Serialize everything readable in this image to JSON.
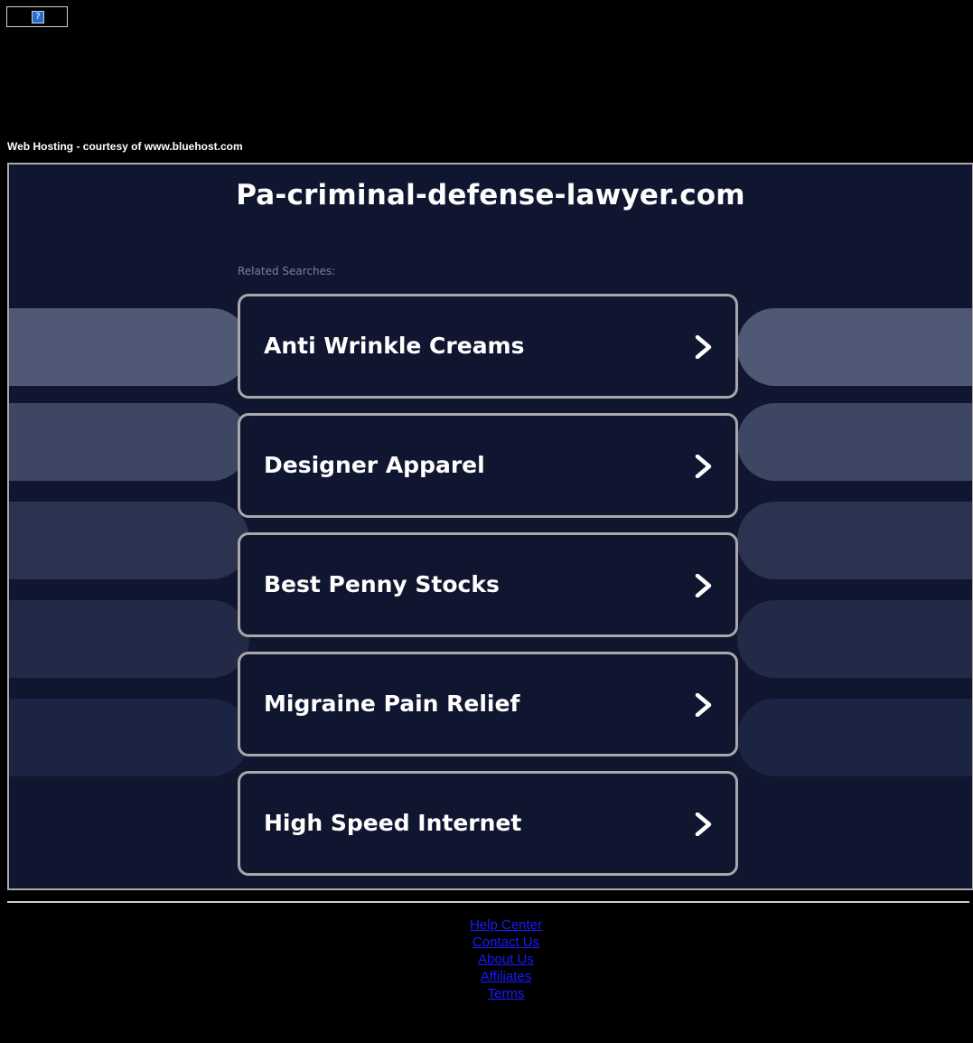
{
  "header": {
    "broken_image_glyph": "?",
    "hosting_text": "Web Hosting - courtesy of www.bluehost.com"
  },
  "main": {
    "site_title": "Pa-criminal-defense-lawyer.com",
    "related_label": "Related Searches:",
    "searches": [
      {
        "label": "Anti Wrinkle Creams"
      },
      {
        "label": "Designer Apparel"
      },
      {
        "label": "Best Penny Stocks"
      },
      {
        "label": "Migraine Pain Relief"
      },
      {
        "label": "High Speed Internet"
      }
    ],
    "band_colors": [
      "#4f5875",
      "#3d4663",
      "#2b3350",
      "#222a47",
      "#1c2444"
    ],
    "chevron_icon": "chevron-right-icon"
  },
  "footer": {
    "links": [
      {
        "label": "Help Center"
      },
      {
        "label": "Contact Us"
      },
      {
        "label": "About Us"
      },
      {
        "label": "Affiliates"
      },
      {
        "label": "Terms"
      }
    ]
  },
  "colors": {
    "page_bg": "#000000",
    "frame_bg": "#111630",
    "card_border": "#a8a8a8",
    "link": "#1a1aff"
  }
}
